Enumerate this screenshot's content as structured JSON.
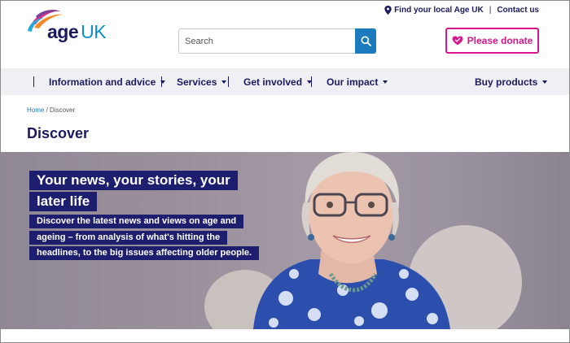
{
  "utility": {
    "find_local": "Find your local Age UK",
    "contact": "Contact us"
  },
  "logo": {
    "word_age": "age",
    "word_uk": "UK"
  },
  "search": {
    "placeholder": "Search"
  },
  "donate": {
    "label": "Please donate"
  },
  "nav": {
    "items": [
      {
        "label": "Information and advice"
      },
      {
        "label": "Services"
      },
      {
        "label": "Get involved"
      },
      {
        "label": "Our impact"
      },
      {
        "label": "Buy products"
      }
    ]
  },
  "breadcrumb": {
    "home": "Home",
    "separator": "/",
    "current": "Discover"
  },
  "page": {
    "title": "Discover"
  },
  "hero": {
    "heading_line1": "Your news, your stories, your",
    "heading_line2": "later life",
    "text_line1": "Discover the latest news and views on age and",
    "text_line2": "ageing – from analysis of what's hitting the",
    "text_line3": "headlines, to the big issues affecting older people."
  },
  "colors": {
    "navy": "#1a1a5e",
    "blue": "#1c7bbd",
    "pink": "#d6178f",
    "nav_bg": "#f0f0f4"
  }
}
